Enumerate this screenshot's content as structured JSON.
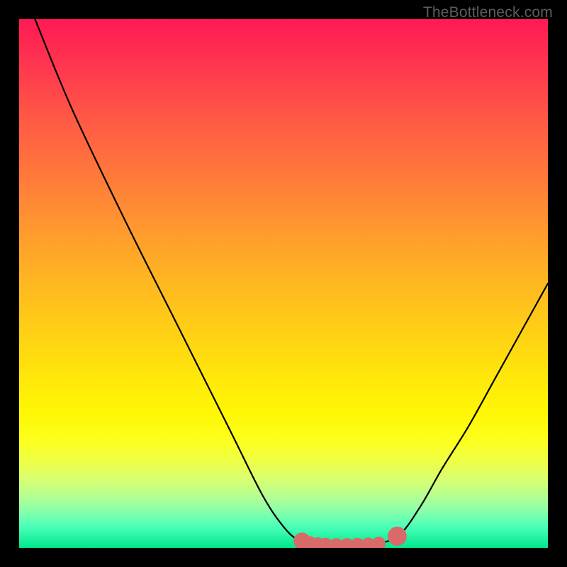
{
  "attribution": "TheBottleneck.com",
  "colors": {
    "curve_stroke": "#000000",
    "marker_stroke": "#d96a6a",
    "marker_fill": "#d96a6a"
  },
  "chart_data": {
    "type": "line",
    "title": "",
    "xlabel": "",
    "ylabel": "",
    "xlim": [
      0,
      100
    ],
    "ylim": [
      0,
      100
    ],
    "series": [
      {
        "name": "bottleneck-curve",
        "x": [
          3,
          10,
          20,
          30,
          40,
          46,
          50,
          53,
          56,
          60,
          62,
          65,
          68,
          72,
          76,
          80,
          85,
          90,
          95,
          100
        ],
        "y": [
          100,
          83,
          62,
          42,
          22,
          10,
          4,
          1.3,
          0.6,
          0.5,
          0.5,
          0.5,
          0.8,
          2.5,
          8,
          15,
          23,
          32,
          41,
          50
        ]
      }
    ],
    "markers": {
      "name": "highlight-dots",
      "x": [
        53.5,
        55.0,
        56.5,
        58.0,
        60.0,
        62.0,
        64.0,
        66.0,
        68.0,
        71.5
      ],
      "y": [
        1.3,
        0.9,
        0.7,
        0.6,
        0.55,
        0.55,
        0.6,
        0.65,
        0.8,
        2.2
      ],
      "r": [
        1.6,
        1.3,
        1.3,
        1.3,
        1.3,
        1.3,
        1.3,
        1.3,
        1.3,
        1.8
      ]
    }
  }
}
